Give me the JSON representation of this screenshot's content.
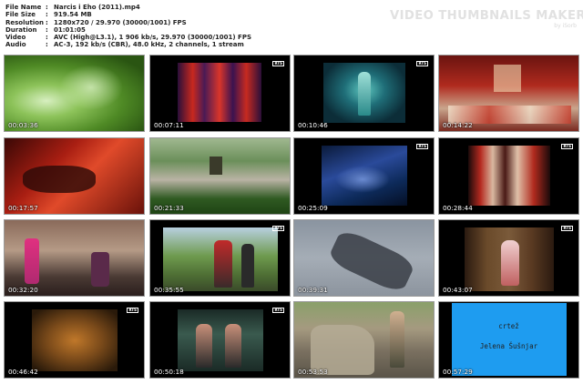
{
  "file_info": [
    {
      "key": "File Name",
      "value": "Narcis i Eho (2011).mp4"
    },
    {
      "key": "File Size",
      "value": "919.54 MB"
    },
    {
      "key": "Resolution",
      "value": "1280x720 / 29.970 (30000/1001) FPS"
    },
    {
      "key": "Duration",
      "value": "01:01:05"
    },
    {
      "key": "Video",
      "value": "AVC (High@L3.1), 1 906 kb/s, 29.970 (30000/1001) FPS"
    },
    {
      "key": "Audio",
      "value": "AC-3, 192 kb/s (CBR), 48.0 kHz, 2 channels, 1 stream"
    }
  ],
  "separator": ":",
  "brand": {
    "title": "VIDEO THUMBNAILS MAKER",
    "subtitle": "by iSorb"
  },
  "channel_logo": "RTS",
  "thumbnails": [
    {
      "time": "00:03:36",
      "scene": "green-foliage"
    },
    {
      "time": "00:07:11",
      "scene": "red-curtains-figures"
    },
    {
      "time": "00:10:46",
      "scene": "teal-figure"
    },
    {
      "time": "00:14:22",
      "scene": "red-train-interior"
    },
    {
      "time": "00:17:57",
      "scene": "red-room-person"
    },
    {
      "time": "00:21:33",
      "scene": "park-path"
    },
    {
      "time": "00:25:09",
      "scene": "blue-crowd"
    },
    {
      "time": "00:28:44",
      "scene": "stage-women"
    },
    {
      "time": "00:32:20",
      "scene": "band-playing"
    },
    {
      "time": "00:35:55",
      "scene": "people-walking"
    },
    {
      "time": "00:39:31",
      "scene": "shadows-pavement"
    },
    {
      "time": "00:43:07",
      "scene": "woman-sitting"
    },
    {
      "time": "00:46:42",
      "scene": "figures-orange"
    },
    {
      "time": "00:50:18",
      "scene": "two-women"
    },
    {
      "time": "00:53:53",
      "scene": "stone-sculpture"
    },
    {
      "time": "00:57:29",
      "scene": "blue-credits"
    }
  ],
  "credits": {
    "line1": "crtež",
    "line2": "Jelena Šušnjar"
  }
}
